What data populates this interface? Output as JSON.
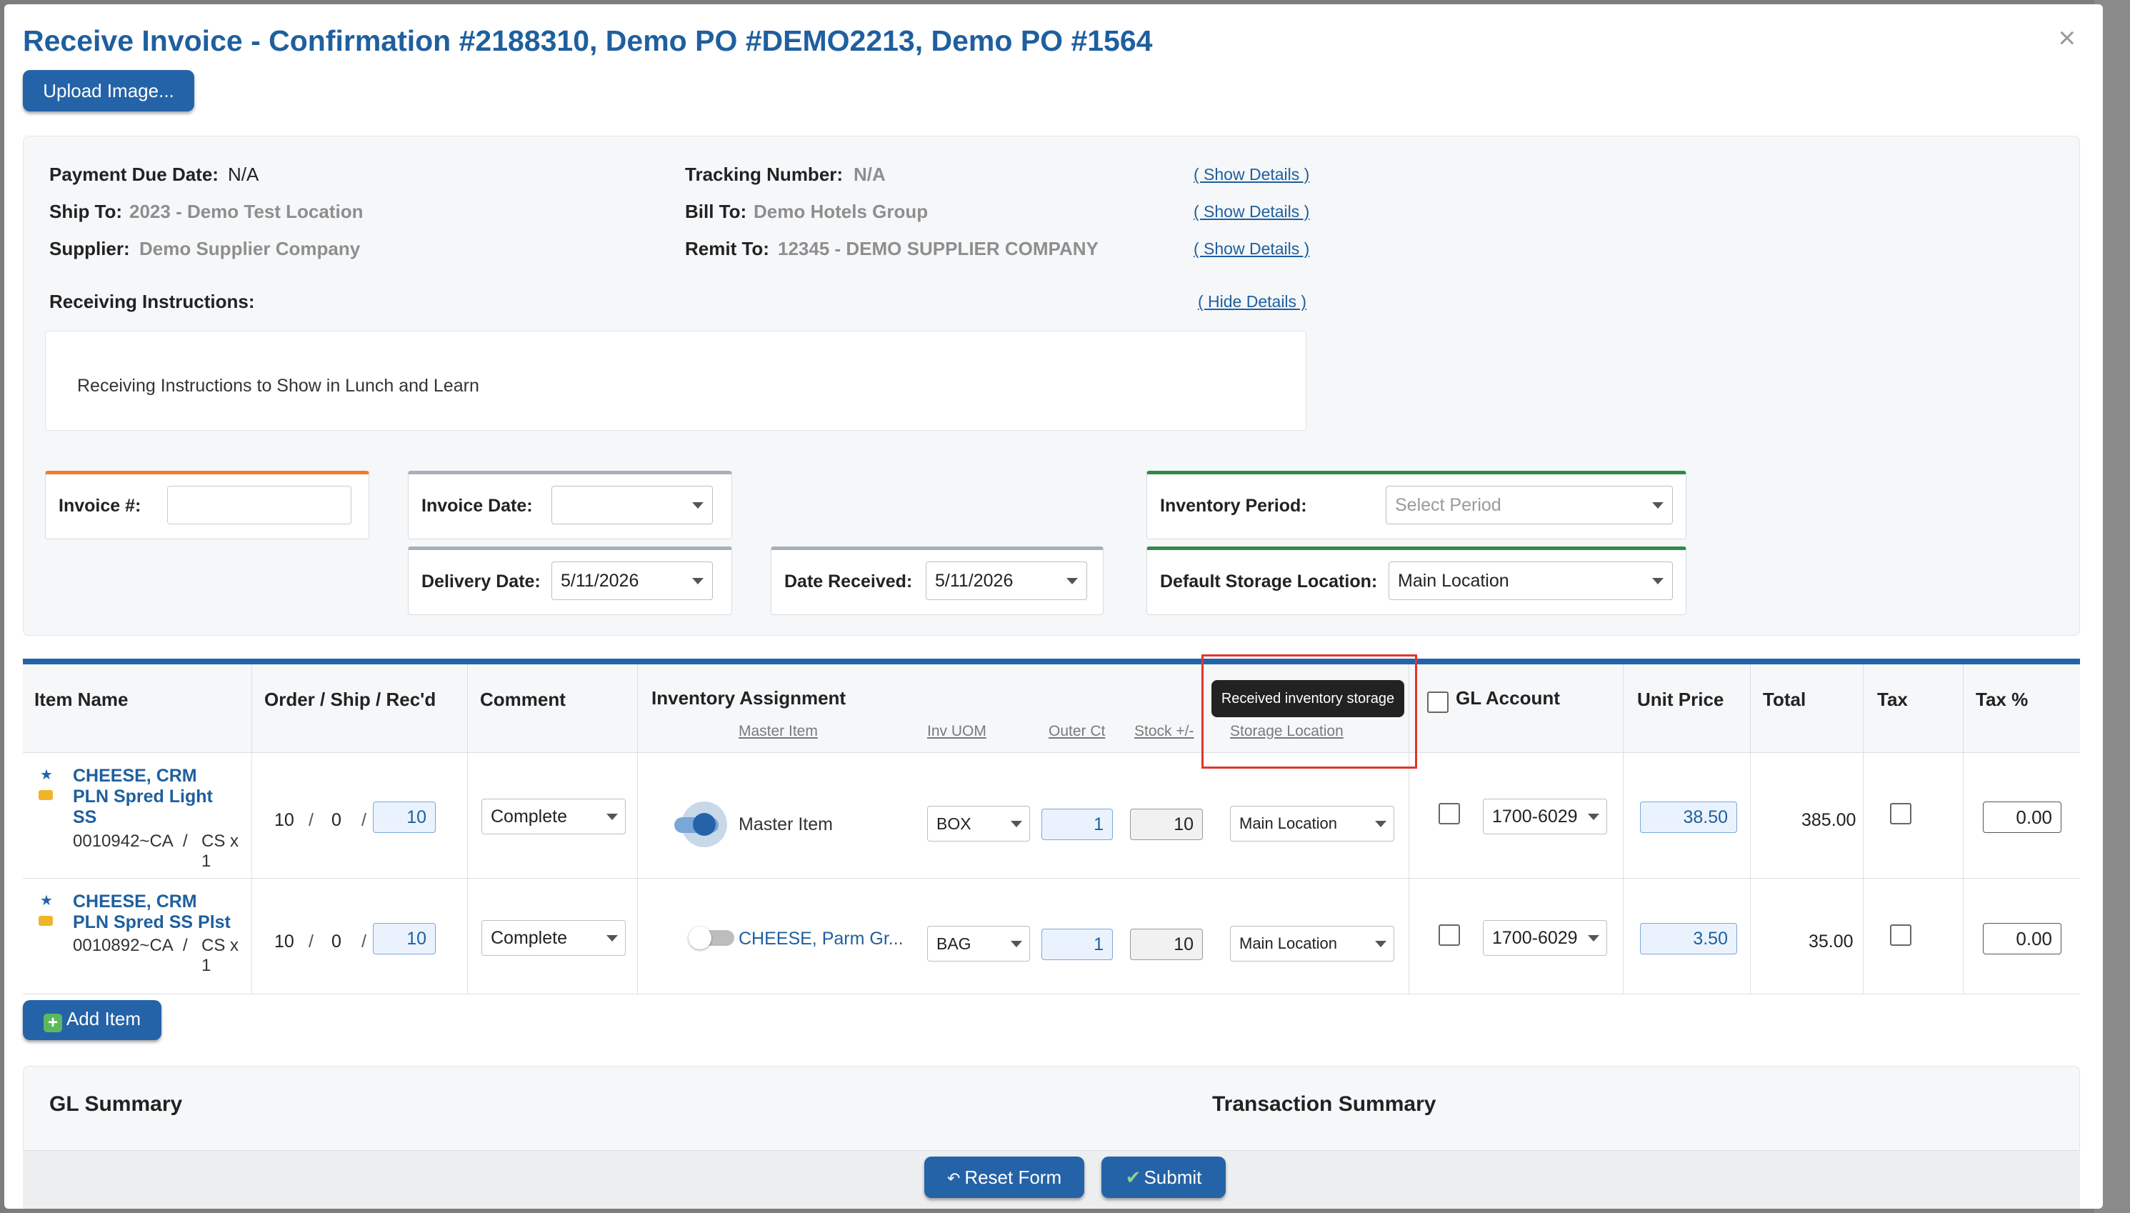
{
  "modal": {
    "title": "Receive Invoice - Confirmation #2188310, Demo PO #DEMO2213, Demo PO #1564",
    "close_label": "×",
    "upload_label": "Upload Image..."
  },
  "info": {
    "payment_due_label": "Payment Due Date:",
    "payment_due_value": "N/A",
    "ship_to_label": "Ship To:",
    "ship_to_value": "2023 - Demo Test Location",
    "supplier_label": "Supplier:",
    "supplier_value": "Demo Supplier Company",
    "tracking_label": "Tracking Number:",
    "tracking_value": "N/A",
    "bill_to_label": "Bill To:",
    "bill_to_value": "Demo Hotels Group",
    "remit_to_label": "Remit To:",
    "remit_to_value": "12345 - DEMO SUPPLIER COMPANY",
    "show_details": "( Show Details )",
    "receiving_instructions_label": "Receiving Instructions:",
    "hide_details": "( Hide Details )",
    "receiving_instructions_text": "Receiving Instructions to Show in Lunch and Learn"
  },
  "form": {
    "invoice_num_label": "Invoice #:",
    "invoice_num_value": "",
    "invoice_date_label": "Invoice Date:",
    "invoice_date_value": "",
    "delivery_date_label": "Delivery Date:",
    "delivery_date_value": "5/11/2026",
    "date_received_label": "Date Received:",
    "date_received_value": "5/11/2026",
    "inventory_period_label": "Inventory Period:",
    "inventory_period_placeholder": "Select Period",
    "default_storage_label": "Default Storage Location:",
    "default_storage_value": "Main Location"
  },
  "table": {
    "headers": {
      "item_name": "Item Name",
      "order_ship_recd": "Order / Ship / Rec'd",
      "comment": "Comment",
      "inventory_assignment": "Inventory Assignment",
      "master_item": "Master Item",
      "inv_uom": "Inv UOM",
      "outer_ct": "Outer Ct",
      "stock": "Stock +/-",
      "storage_location": "Storage Location",
      "gl_account": "GL Account",
      "unit_price": "Unit Price",
      "total": "Total",
      "tax": "Tax",
      "tax_pct": "Tax %"
    },
    "tooltip": "Received inventory storage",
    "rows": [
      {
        "name": "CHEESE, CRM PLN Spred Light SS",
        "code": "0010942~CA",
        "unit": "CS x 1",
        "order": "10",
        "ship": "0",
        "recd": "10",
        "comment": "Complete",
        "master_on": true,
        "master_label": "Master Item",
        "uom": "BOX",
        "outer_ct": "1",
        "stock": "10",
        "storage": "Main Location",
        "gl": "1700-6029",
        "unit_price": "38.50",
        "total": "385.00",
        "tax_pct": "0.00"
      },
      {
        "name": "CHEESE, CRM PLN Spred SS Plst",
        "code": "0010892~CA",
        "unit": "CS x 1",
        "order": "10",
        "ship": "0",
        "recd": "10",
        "comment": "Complete",
        "master_on": false,
        "master_label": "CHEESE, Parm Gr...",
        "uom": "BAG",
        "outer_ct": "1",
        "stock": "10",
        "storage": "Main Location",
        "gl": "1700-6029",
        "unit_price": "3.50",
        "total": "35.00",
        "tax_pct": "0.00"
      }
    ]
  },
  "actions": {
    "add_item": "Add Item",
    "reset": "Reset Form",
    "submit": "Submit"
  },
  "summary": {
    "gl_summary": "GL Summary",
    "transaction_summary": "Transaction Summary"
  },
  "colors": {
    "brand_blue": "#2563a8",
    "title_blue": "#1f5f9e",
    "highlight_red": "#e0352b",
    "accent_orange": "#f07c2a",
    "accent_green": "#2f8a4a"
  }
}
